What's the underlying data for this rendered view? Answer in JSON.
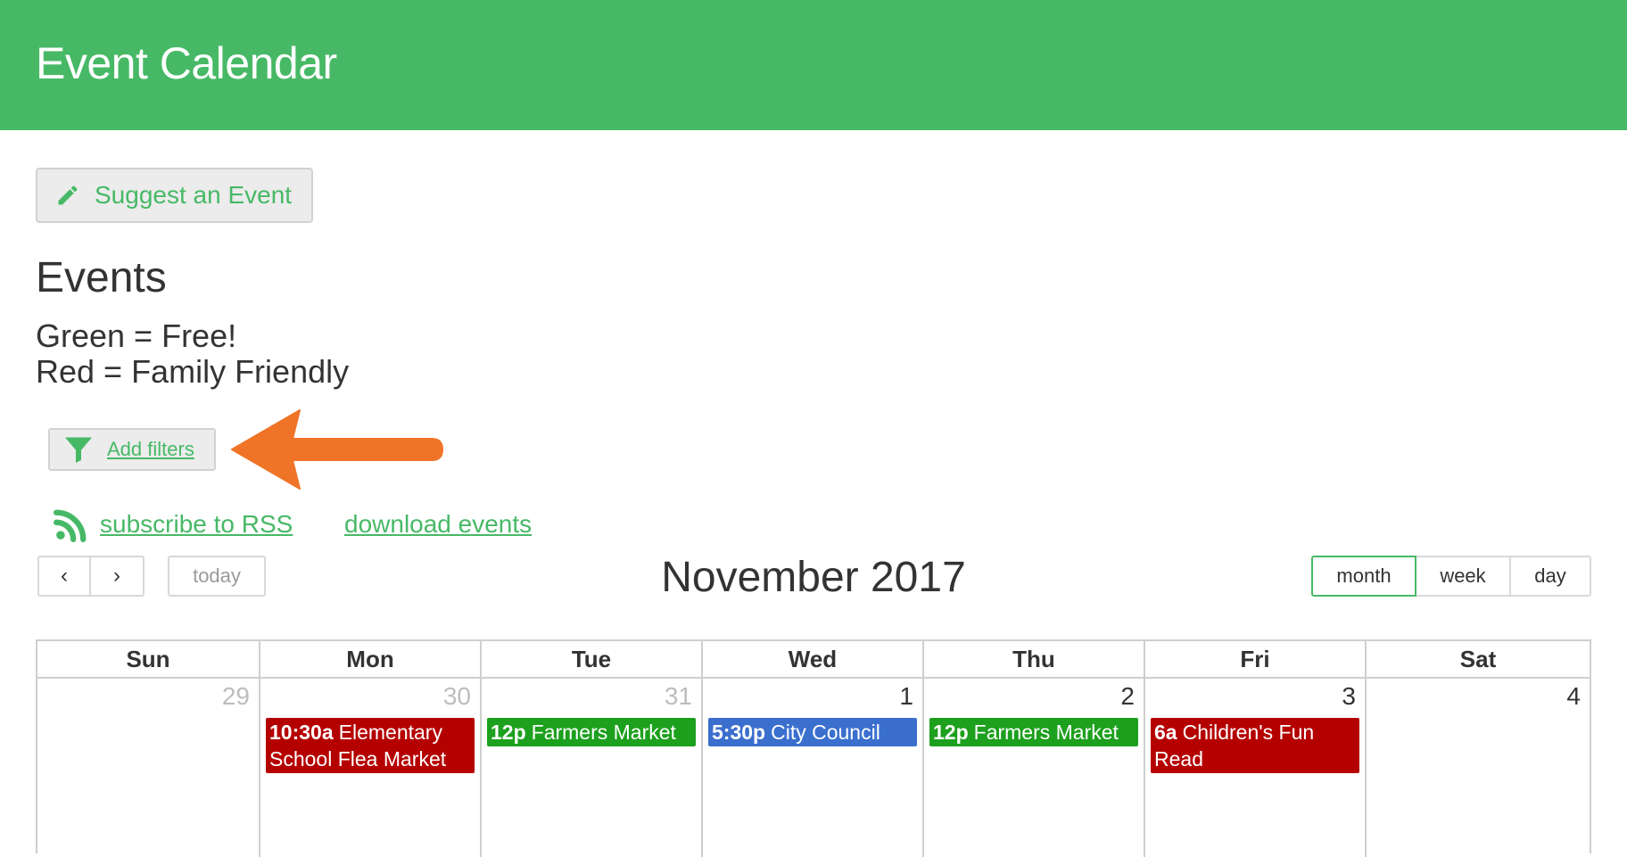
{
  "header": {
    "title": "Event Calendar",
    "color": "#47b966"
  },
  "actions": {
    "suggest_label": "Suggest an Event",
    "suggest_icon": "pencil-icon"
  },
  "events_section": {
    "heading": "Events",
    "legend": [
      "Green = Free!",
      "Red = Family Friendly"
    ]
  },
  "filters": {
    "label": "Add filters",
    "icon": "filter-icon"
  },
  "annotation": {
    "icon": "orange-arrow-pointer",
    "color": "#f07427"
  },
  "links": {
    "rss": "subscribe to RSS",
    "rss_icon": "rss-icon",
    "download": "download events"
  },
  "toolbar": {
    "prev": "‹",
    "next": "›",
    "today": "today",
    "title": "November 2017",
    "views": [
      "month",
      "week",
      "day"
    ],
    "active_view": "month"
  },
  "calendar": {
    "weekdays": [
      "Sun",
      "Mon",
      "Tue",
      "Wed",
      "Thu",
      "Fri",
      "Sat"
    ],
    "days": [
      {
        "num": "29",
        "other_month": true,
        "event": null
      },
      {
        "num": "30",
        "other_month": true,
        "event": {
          "time": "10:30a",
          "title": "Elementary School Flea Market",
          "color": "red"
        }
      },
      {
        "num": "31",
        "other_month": true,
        "event": {
          "time": "12p",
          "title": "Farmers Market",
          "color": "green"
        }
      },
      {
        "num": "1",
        "other_month": false,
        "event": {
          "time": "5:30p",
          "title": "City Council",
          "color": "blue"
        }
      },
      {
        "num": "2",
        "other_month": false,
        "event": {
          "time": "12p",
          "title": "Farmers Market",
          "color": "green"
        }
      },
      {
        "num": "3",
        "other_month": false,
        "event": {
          "time": "6a",
          "title": "Children's Fun Read",
          "color": "red"
        }
      },
      {
        "num": "4",
        "other_month": false,
        "event": null
      }
    ]
  }
}
